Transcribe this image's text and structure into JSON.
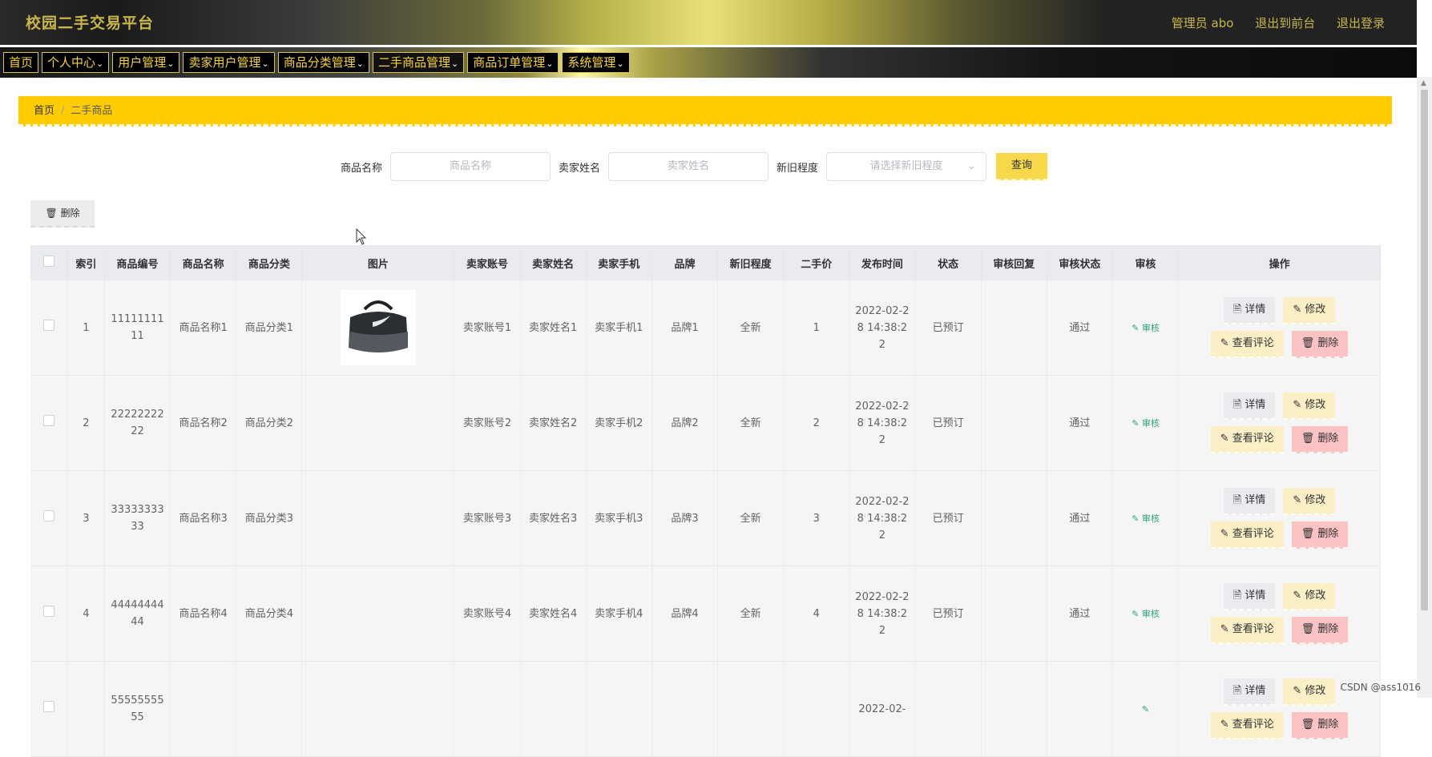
{
  "header": {
    "title": "校园二手交易平台",
    "user": "管理员 abo",
    "links": [
      "退出到前台",
      "退出登录"
    ]
  },
  "nav": {
    "items": [
      {
        "label": "首页",
        "has_menu": false
      },
      {
        "label": "个人中心",
        "has_menu": true
      },
      {
        "label": "用户管理",
        "has_menu": true
      },
      {
        "label": "卖家用户管理",
        "has_menu": true
      },
      {
        "label": "商品分类管理",
        "has_menu": true
      },
      {
        "label": "二手商品管理",
        "has_menu": true
      },
      {
        "label": "商品订单管理",
        "has_menu": true
      },
      {
        "label": "系统管理",
        "has_menu": true
      }
    ]
  },
  "breadcrumb": {
    "home": "首页",
    "separator": "/",
    "current": "二手商品"
  },
  "search": {
    "name_label": "商品名称",
    "name_placeholder": "商品名称",
    "seller_label": "卖家姓名",
    "seller_placeholder": "卖家姓名",
    "condition_label": "新旧程度",
    "condition_placeholder": "请选择新旧程度",
    "query_label": "查询"
  },
  "toolbar": {
    "delete_label": "删除"
  },
  "table": {
    "columns": [
      "索引",
      "商品编号",
      "商品名称",
      "商品分类",
      "图片",
      "卖家账号",
      "卖家姓名",
      "卖家手机",
      "品牌",
      "新旧程度",
      "二手价",
      "发布时间",
      "状态",
      "审核回复",
      "审核状态",
      "审核",
      "操作"
    ],
    "rows": [
      {
        "index": "1",
        "code": "1111111111",
        "name": "商品名称1",
        "category": "商品分类1",
        "has_image": true,
        "seller_account": "卖家账号1",
        "seller_name": "卖家姓名1",
        "seller_phone": "卖家手机1",
        "brand": "品牌1",
        "condition": "全新",
        "price": "1",
        "time": "2022-02-28 14:38:22",
        "status": "已预订",
        "reply": "",
        "audit_status": "通过",
        "audit": "审核"
      },
      {
        "index": "2",
        "code": "2222222222",
        "name": "商品名称2",
        "category": "商品分类2",
        "has_image": false,
        "seller_account": "卖家账号2",
        "seller_name": "卖家姓名2",
        "seller_phone": "卖家手机2",
        "brand": "品牌2",
        "condition": "全新",
        "price": "2",
        "time": "2022-02-28 14:38:22",
        "status": "已预订",
        "reply": "",
        "audit_status": "通过",
        "audit": "审核"
      },
      {
        "index": "3",
        "code": "3333333333",
        "name": "商品名称3",
        "category": "商品分类3",
        "has_image": false,
        "seller_account": "卖家账号3",
        "seller_name": "卖家姓名3",
        "seller_phone": "卖家手机3",
        "brand": "品牌3",
        "condition": "全新",
        "price": "3",
        "time": "2022-02-28 14:38:22",
        "status": "已预订",
        "reply": "",
        "audit_status": "通过",
        "audit": "审核"
      },
      {
        "index": "4",
        "code": "4444444444",
        "name": "商品名称4",
        "category": "商品分类4",
        "has_image": false,
        "seller_account": "卖家账号4",
        "seller_name": "卖家姓名4",
        "seller_phone": "卖家手机4",
        "brand": "品牌4",
        "condition": "全新",
        "price": "4",
        "time": "2022-02-28 14:38:22",
        "status": "已预订",
        "reply": "",
        "audit_status": "通过",
        "audit": "审核"
      },
      {
        "index": "",
        "code": "5555555555",
        "name": "",
        "category": "",
        "has_image": false,
        "seller_account": "",
        "seller_name": "",
        "seller_phone": "",
        "brand": "",
        "condition": "",
        "price": "",
        "time": "2022-02-",
        "status": "",
        "reply": "",
        "audit_status": "",
        "audit": ""
      }
    ],
    "actions": {
      "detail": "详情",
      "edit": "修改",
      "comment": "查看评论",
      "delete": "删除"
    }
  },
  "watermark": "CSDN @ass1016",
  "colors": {
    "accent": "#ffcc00",
    "query_button": "#f7d84a",
    "delete_button": "#fbc3c3",
    "edit_button": "#fbefc6",
    "audit_link": "#2da47c"
  }
}
